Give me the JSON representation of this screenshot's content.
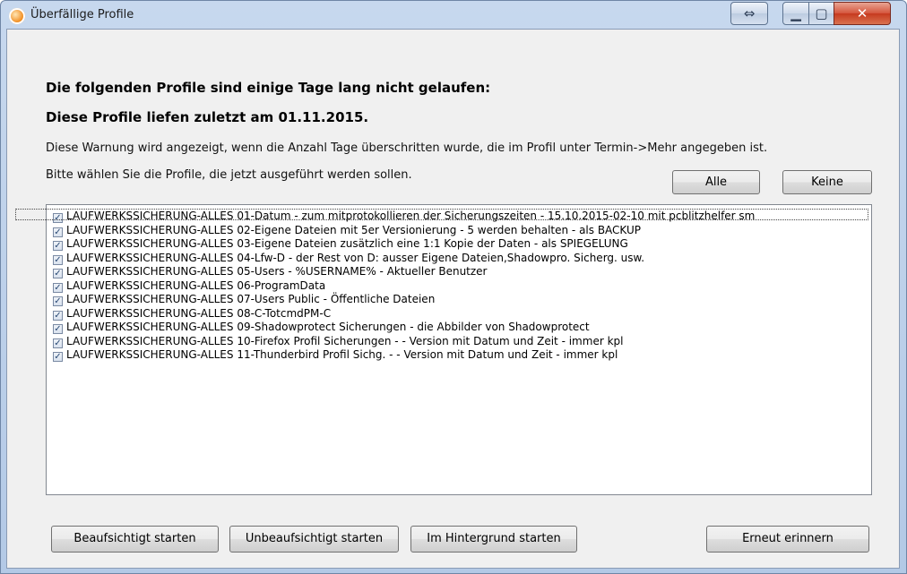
{
  "window": {
    "title": "Überfällige Profile"
  },
  "caption_buttons": {
    "resize_icon": "⇔",
    "minimize_icon": "▁",
    "maximize_icon": "▢",
    "close_icon": "✕"
  },
  "header": {
    "line1": "Die folgenden Profile sind einige Tage lang nicht gelaufen:",
    "line2": "Diese Profile liefen zuletzt am 01.11.2015.",
    "info": "Diese Warnung wird angezeigt, wenn die Anzahl Tage überschritten wurde, die im Profil unter Termin->Mehr angegeben ist.",
    "select_prompt": "Bitte wählen Sie die Profile, die jetzt ausgeführt werden sollen."
  },
  "selection_buttons": {
    "all": "Alle",
    "none": "Keine"
  },
  "profiles": [
    {
      "label": "LAUFWERKSSICHERUNG-ALLES 01-Datum - zum mitprotokollieren der Sicherungszeiten - 15.10.2015-02-10 mit pcblitzhelfer sm",
      "checked": true
    },
    {
      "label": "LAUFWERKSSICHERUNG-ALLES 02-Eigene Dateien mit 5er Versionierung - 5 werden behalten - als BACKUP",
      "checked": true
    },
    {
      "label": "LAUFWERKSSICHERUNG-ALLES 03-Eigene Dateien zusätzlich eine 1:1 Kopie der Daten - als SPIEGELUNG",
      "checked": true
    },
    {
      "label": "LAUFWERKSSICHERUNG-ALLES 04-Lfw-D - der Rest von D: ausser Eigene Dateien,Shadowpro. Sicherg. usw.",
      "checked": true
    },
    {
      "label": "LAUFWERKSSICHERUNG-ALLES 05-Users - %USERNAME%  - Aktueller Benutzer",
      "checked": true
    },
    {
      "label": "LAUFWERKSSICHERUNG-ALLES 06-ProgramData",
      "checked": true
    },
    {
      "label": "LAUFWERKSSICHERUNG-ALLES 07-Users Public - Öffentliche Dateien",
      "checked": true
    },
    {
      "label": "LAUFWERKSSICHERUNG-ALLES 08-C-TotcmdPM-C",
      "checked": true
    },
    {
      "label": "LAUFWERKSSICHERUNG-ALLES 09-Shadowprotect Sicherungen - die Abbilder von Shadowprotect",
      "checked": true
    },
    {
      "label": "LAUFWERKSSICHERUNG-ALLES 10-Firefox Profil Sicherungen - - Version mit Datum und Zeit - immer kpl",
      "checked": true
    },
    {
      "label": "LAUFWERKSSICHERUNG-ALLES 11-Thunderbird Profil Sichg. - - Version mit Datum und Zeit - immer kpl",
      "checked": true
    }
  ],
  "actions": {
    "supervised": "Beaufsichtigt starten",
    "unsupervised": "Unbeaufsichtigt starten",
    "background": "Im Hintergrund starten",
    "remind": "Erneut erinnern"
  }
}
